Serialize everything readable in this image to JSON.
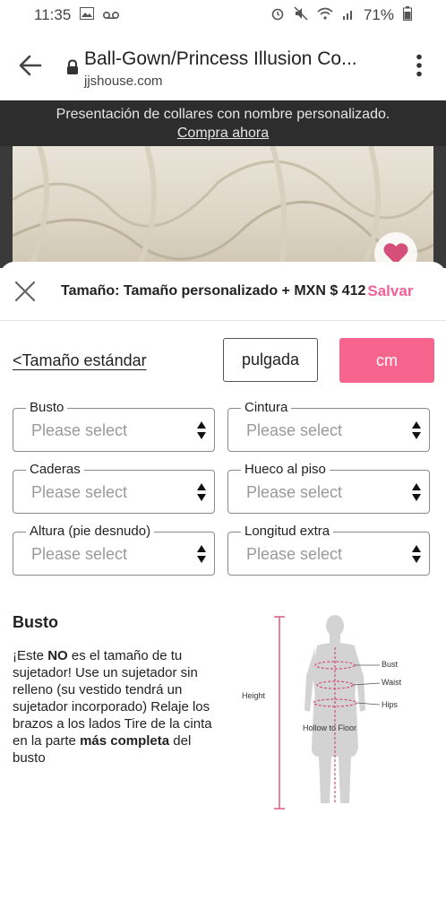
{
  "status_bar": {
    "time": "11:35",
    "battery": "71%"
  },
  "browser": {
    "page_title": "Ball-Gown/Princess Illusion Co...",
    "domain": "jjshouse.com"
  },
  "promo": {
    "text": "Presentación de collares con nombre personalizado.",
    "link": "Compra ahora"
  },
  "sheet": {
    "title": "Tamaño: Tamaño personalizado + MXN $ 412",
    "save_label": "Salvar",
    "standard_size_link": "<Tamaño estándar",
    "unit_inch": "pulgada",
    "unit_cm": "cm",
    "fields": [
      {
        "label": "Busto",
        "value": "Please select"
      },
      {
        "label": "Cintura",
        "value": "Please select"
      },
      {
        "label": "Caderas",
        "value": "Please select"
      },
      {
        "label": "Hueco al piso",
        "value": "Please select"
      },
      {
        "label": "Altura (pie desnudo)",
        "value": "Please select"
      },
      {
        "label": "Longitud extra",
        "value": "Please select"
      }
    ],
    "info": {
      "title": "Busto",
      "part1": "¡Este ",
      "bold1": "NO",
      "part2": " es el tamaño de tu sujetador! Use un sujetador sin relleno (su vestido tendrá un sujetador incorporado) Relaje los brazos a los lados Tire de la cinta en la parte ",
      "bold2": "más completa",
      "part3": " del busto"
    },
    "diagram": {
      "height": "Height",
      "bust": "Bust",
      "waist": "Waist",
      "hips": "Hips",
      "hollow": "Hollow to Floor"
    }
  },
  "colors": {
    "accent": "#f7658f",
    "promo_bg": "#2d2d2d",
    "measure": "#d64f7a"
  }
}
